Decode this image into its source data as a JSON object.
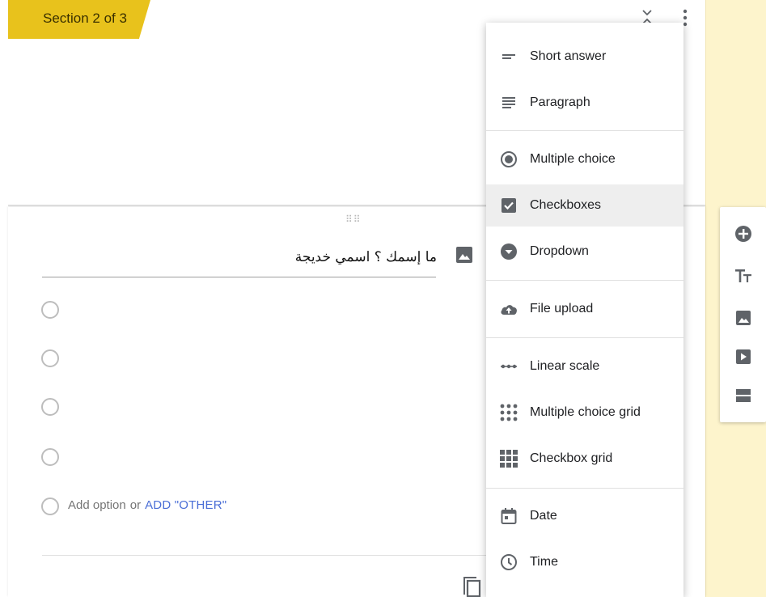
{
  "header": {
    "section_label": "Section 2 of 3"
  },
  "question": {
    "title": "ما إسمك ؟ اسمي خديجة",
    "options_count": 4,
    "add_option_label": "Add option",
    "or_label": "or",
    "add_other_label": "ADD \"OTHER\""
  },
  "menu": {
    "items": [
      {
        "label": "Short answer",
        "icon": "short-answer-icon"
      },
      {
        "label": "Paragraph",
        "icon": "paragraph-icon"
      },
      {
        "label": "Multiple choice",
        "icon": "radio-button-icon"
      },
      {
        "label": "Checkboxes",
        "icon": "checkbox-icon",
        "selected": true
      },
      {
        "label": "Dropdown",
        "icon": "dropdown-icon"
      },
      {
        "label": "File upload",
        "icon": "cloud-upload-icon"
      },
      {
        "label": "Linear scale",
        "icon": "linear-scale-icon"
      },
      {
        "label": "Multiple choice grid",
        "icon": "dot-grid-icon"
      },
      {
        "label": "Checkbox grid",
        "icon": "square-grid-icon"
      },
      {
        "label": "Date",
        "icon": "calendar-icon"
      },
      {
        "label": "Time",
        "icon": "clock-icon"
      }
    ]
  },
  "toolbar": {
    "icons": [
      "add-question-icon",
      "title-text-icon",
      "add-image-icon",
      "add-video-icon",
      "add-section-icon"
    ]
  },
  "colors": {
    "section_tab": "#e8c21c",
    "side_strip": "#fdf4cc",
    "accent_link": "#4a6ed6",
    "icon_gray": "#5f6368"
  }
}
